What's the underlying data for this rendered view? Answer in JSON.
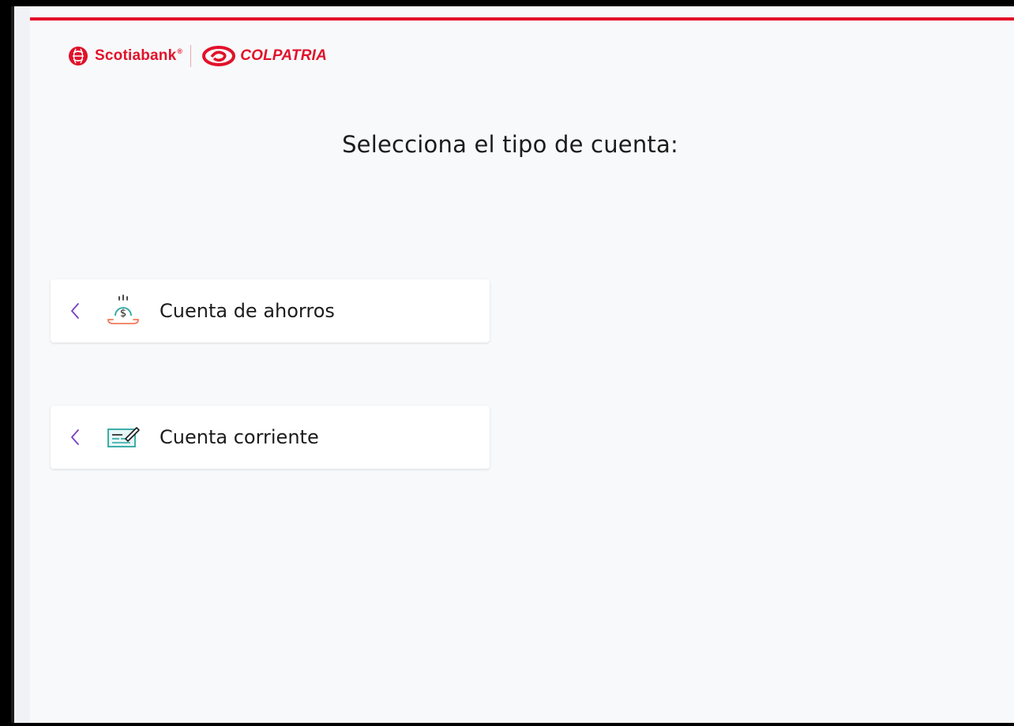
{
  "brand": {
    "scotiabank": "Scotiabank",
    "registered": "®",
    "colpatria": "COLPATRIA",
    "primary_color": "#e2112a"
  },
  "page": {
    "title": "Selecciona el tipo de cuenta:"
  },
  "options": [
    {
      "label": "Cuenta de ahorros",
      "icon": "savings-coin-icon",
      "chevron": "chevron-left-icon"
    },
    {
      "label": "Cuenta corriente",
      "icon": "check-document-icon",
      "chevron": "chevron-left-icon"
    }
  ],
  "colors": {
    "accent_chevron": "#7a3fc2",
    "icon_teal": "#2aa6a0",
    "icon_coral": "#f07a5a"
  }
}
